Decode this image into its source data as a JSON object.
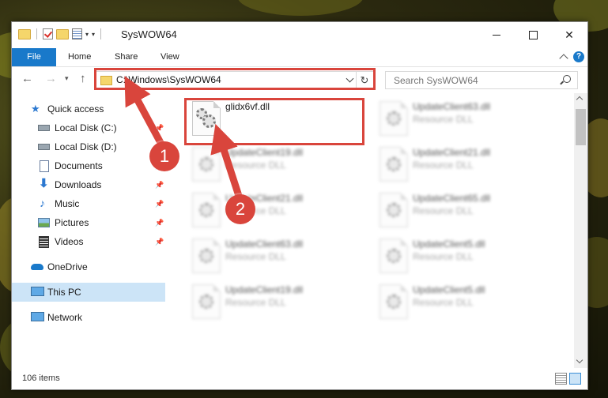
{
  "window": {
    "title": "SysWOW64",
    "icons": {
      "folder": "folder-icon",
      "check": "checkmark-icon",
      "properties": "properties-icon"
    }
  },
  "ribbon": {
    "tabs": [
      "File",
      "Home",
      "Share",
      "View"
    ],
    "help_label": "?"
  },
  "navigation": {
    "address": "C:\\Windows\\SysWOW64",
    "search_placeholder": "Search SysWOW64"
  },
  "sidebar": {
    "items": [
      {
        "label": "Quick access",
        "icon": "star-icon",
        "pinned": false
      },
      {
        "label": "Local Disk (C:)",
        "icon": "drive-icon",
        "pinned": true
      },
      {
        "label": "Local Disk (D:)",
        "icon": "drive-icon",
        "pinned": false
      },
      {
        "label": "Documents",
        "icon": "documents-icon",
        "pinned": true
      },
      {
        "label": "Downloads",
        "icon": "download-icon",
        "pinned": true
      },
      {
        "label": "Music",
        "icon": "music-icon",
        "pinned": true
      },
      {
        "label": "Pictures",
        "icon": "pictures-icon",
        "pinned": true
      },
      {
        "label": "Videos",
        "icon": "videos-icon",
        "pinned": true
      },
      {
        "label": "OneDrive",
        "icon": "cloud-icon",
        "pinned": false
      },
      {
        "label": "This PC",
        "icon": "computer-icon",
        "pinned": false,
        "selected": true
      },
      {
        "label": "Network",
        "icon": "network-icon",
        "pinned": false
      }
    ]
  },
  "files": {
    "highlighted": {
      "name": "glidx6vf.dll",
      "type": ""
    },
    "col1": [
      {
        "name": "UpdateClient19.dll",
        "type": "Resource DLL"
      },
      {
        "name": "UpdateClient21.dll",
        "type": "Resource DLL"
      },
      {
        "name": "UpdateClient63.dll",
        "type": "Resource DLL"
      },
      {
        "name": "UpdateClient19.dll",
        "type": "Resource DLL"
      }
    ],
    "col2": [
      {
        "name": "UpdateClient63.dll",
        "type": "Resource DLL"
      },
      {
        "name": "UpdateClient21.dll",
        "type": "Resource DLL"
      },
      {
        "name": "UpdateClient65.dll",
        "type": "Resource DLL"
      },
      {
        "name": "UpdateClient5.dll",
        "type": "Resource DLL"
      },
      {
        "name": "UpdateClient5.dll",
        "type": "Resource DLL"
      }
    ]
  },
  "status": {
    "item_count": "106 items"
  },
  "annotations": {
    "callout1": "1",
    "callout2": "2",
    "highlight_color": "#d9453c"
  },
  "colors": {
    "accent": "#1979ca",
    "selection": "#cce4f7"
  }
}
